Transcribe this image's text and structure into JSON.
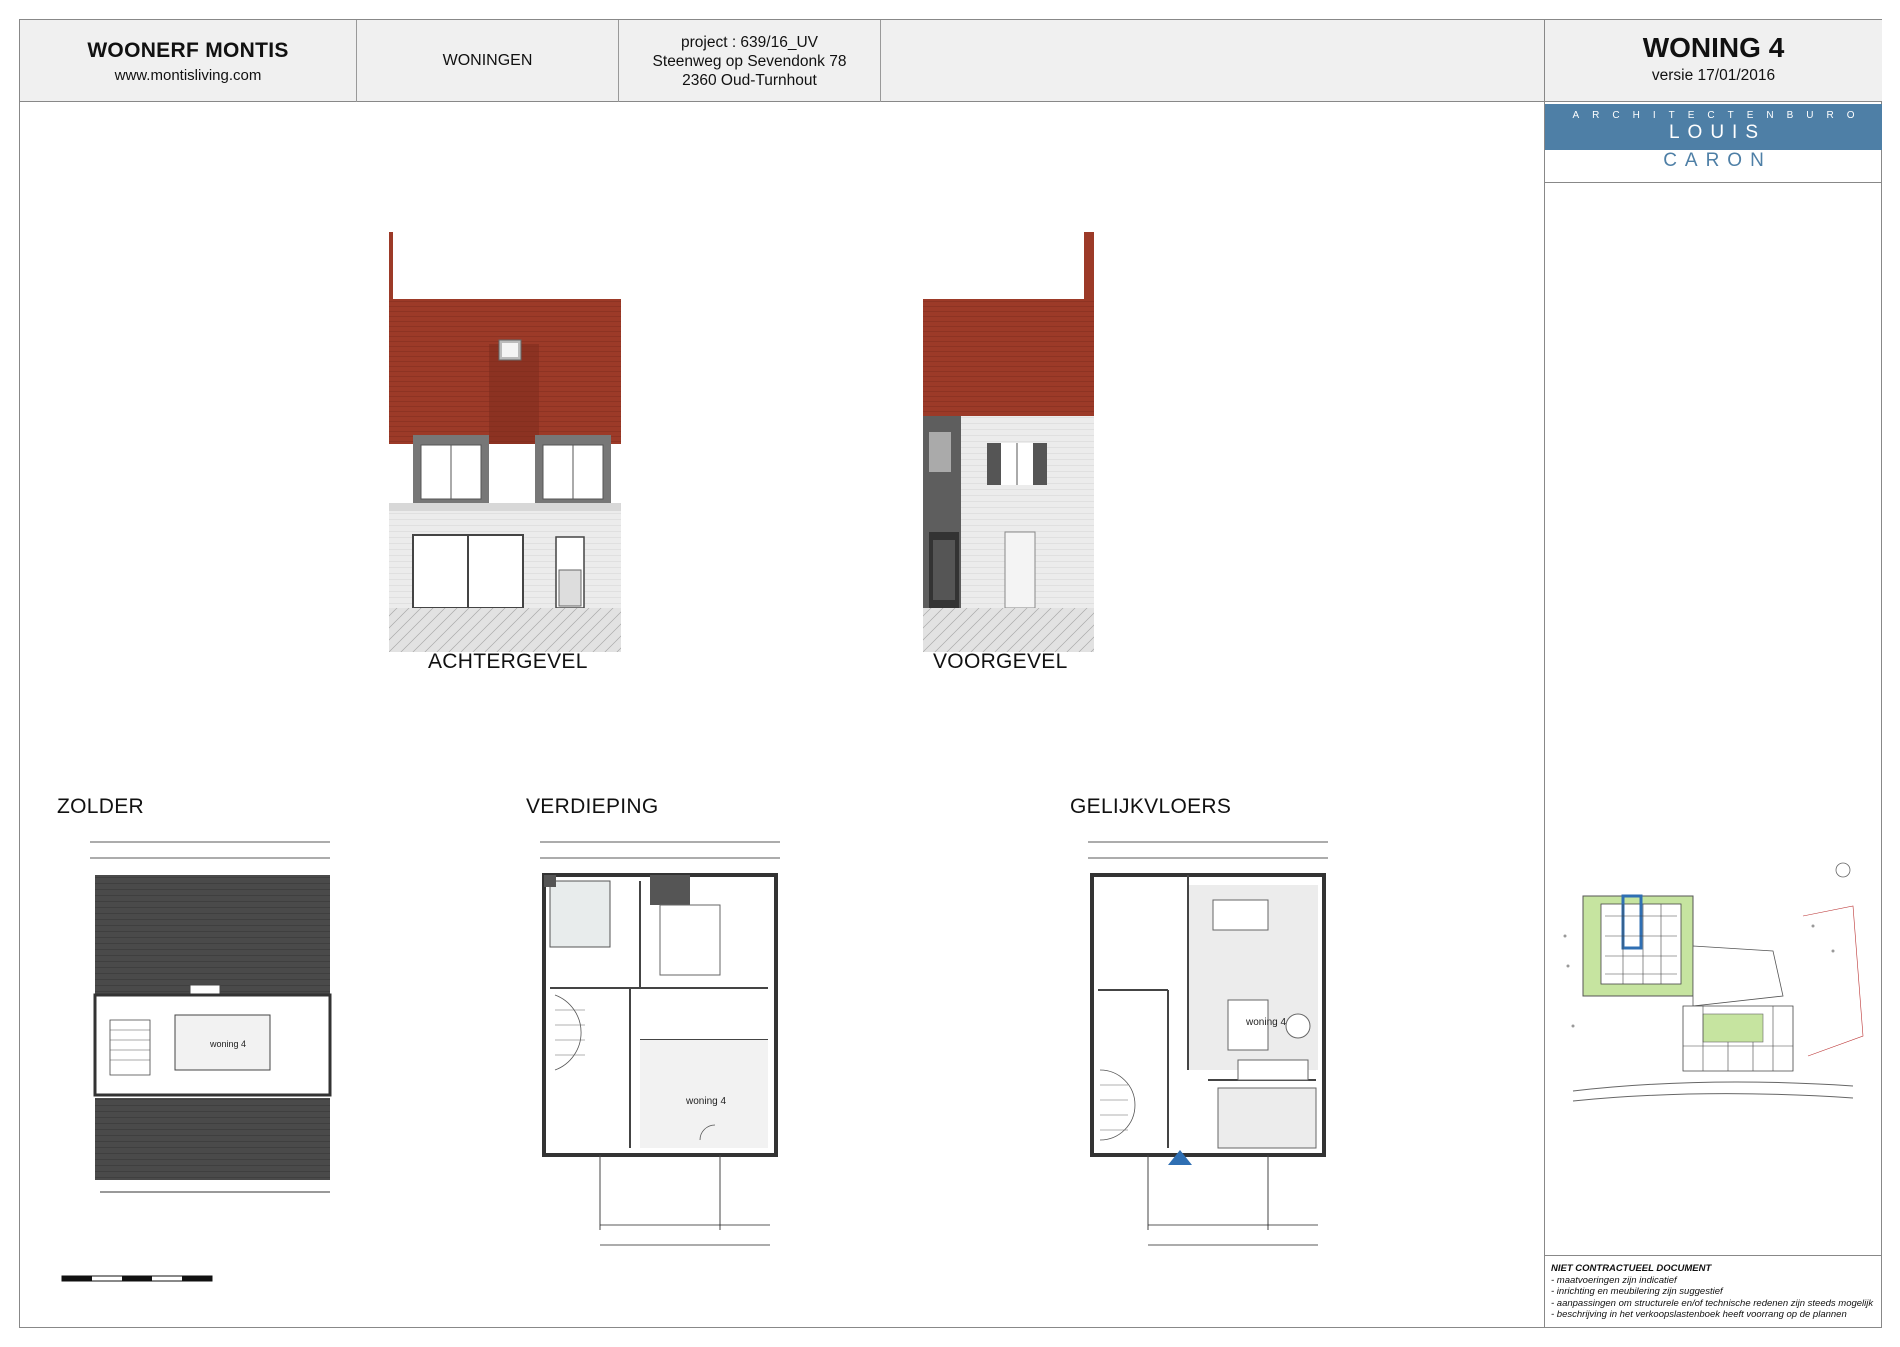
{
  "header": {
    "brand": "WOONERF MONTIS",
    "url": "www.montisliving.com",
    "category": "WONINGEN",
    "project_line1": "project : 639/16_UV",
    "project_line2": "Steenweg op Sevendonk 78",
    "project_line3": "2360 Oud-Turnhout"
  },
  "unit": {
    "title": "WONING 4",
    "version": "versie 17/01/2016"
  },
  "logo": {
    "line1": "ARCHITECTENBURO",
    "line2": "LOUIS",
    "line3": "CARON"
  },
  "elevations": {
    "rear": "ACHTERGEVEL",
    "front": "VOORGEVEL"
  },
  "floorplans": {
    "attic": {
      "title": "ZOLDER",
      "room_label": "woning 4"
    },
    "upper": {
      "title": "VERDIEPING",
      "room_label": "woning 4"
    },
    "ground": {
      "title": "GELIJKVLOERS",
      "room_label": "woning 4"
    }
  },
  "notes": {
    "heading": "NIET CONTRACTUEEL DOCUMENT",
    "lines": [
      "- maatvoeringen zijn indicatief",
      "- inrichting en meubilering zijn suggestief",
      "- aanpassingen om structurele en/of technische redenen zijn steeds mogelijk",
      "- beschrijving in het verkoopslastenboek heeft voorrang op de plannen"
    ]
  },
  "colors": {
    "roof": "#9c3a28",
    "wall": "#e9e9e9",
    "accent": "#4e7fa6",
    "green": "#8ec63f"
  }
}
